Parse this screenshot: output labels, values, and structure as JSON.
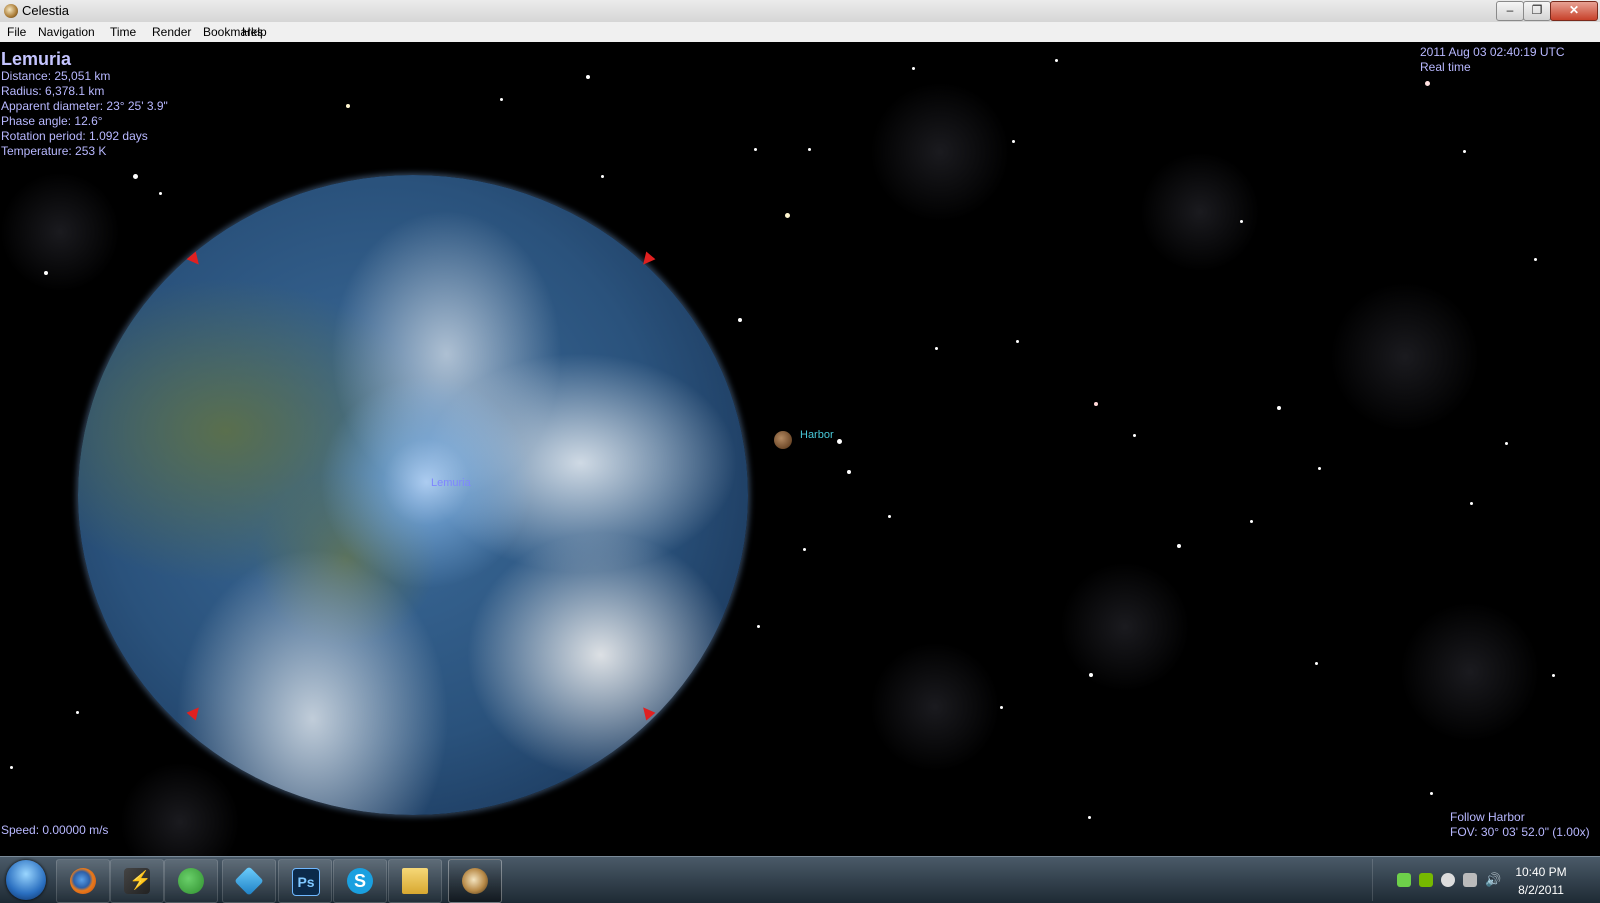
{
  "window": {
    "title": "Celestia",
    "buttons": {
      "minimize": "–",
      "maximize": "❐",
      "close": "✕"
    }
  },
  "menu": [
    "File",
    "Navigation",
    "Time",
    "Render",
    "Bookmarks",
    "Help"
  ],
  "object_info": {
    "name": "Lemuria",
    "distance": "Distance: 25,051 km",
    "radius": "Radius: 6,378.1 km",
    "apparent_diameter": "Apparent diameter: 23° 25' 3.9\"",
    "phase_angle": "Phase angle: 12.6°",
    "rotation_period": "Rotation period: 1.092 days",
    "temperature": "Temperature: 253 K"
  },
  "time": {
    "datetime": "2011 Aug 03 02:40:19 UTC",
    "mode": "Real time"
  },
  "labels": {
    "planet": "Lemuria",
    "moon": "Harbor"
  },
  "status": {
    "speed": "Speed: 0.00000 m/s",
    "follow": "Follow Harbor",
    "fov": "FOV: 30° 03' 52.0\" (1.00x)"
  },
  "taskbar": {
    "apps": [
      "start-orb-icon",
      "firefox-icon",
      "winamp-icon",
      "messenger-icon",
      "cube-app-icon",
      "photoshop-icon",
      "skype-icon",
      "folder-icon",
      "celestia-icon"
    ],
    "photoshop_label": "Ps",
    "skype_label": "S",
    "clock_time": "10:40 PM",
    "clock_date": "8/2/2011"
  },
  "colors": {
    "hud_text": "#b8b8ff",
    "planet_label": "#7f86ff",
    "moon_label": "#48c8d8",
    "marker": "#e02020"
  }
}
